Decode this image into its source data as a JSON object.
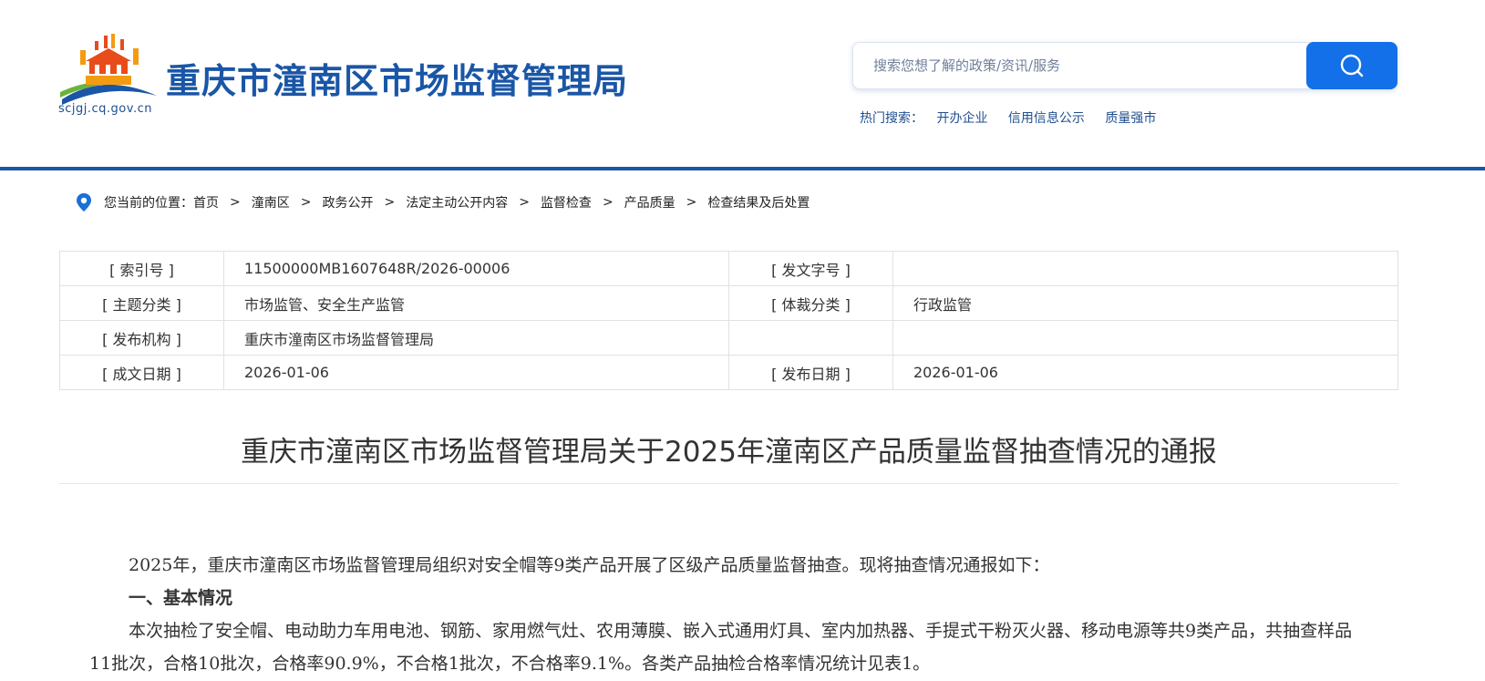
{
  "header": {
    "site_title": "重庆市潼南区市场监督管理局",
    "domain": "scjgj.cq.gov.cn",
    "search_placeholder": "搜索您想了解的政策/资讯/服务",
    "hot_label": "热门搜索：",
    "hot_links": [
      "开办企业",
      "信用信息公示",
      "质量强市"
    ],
    "brand_color": "#1a56a6",
    "search_button_color": "#1370e8",
    "search_icon": "search-icon"
  },
  "breadcrumb": {
    "prefix": "您当前的位置：",
    "icon": "location-pin-icon",
    "items": [
      "首页",
      "潼南区",
      "政务公开",
      "法定主动公开内容",
      "监督检查",
      "产品质量",
      "检查结果及后处置"
    ],
    "separator": ">"
  },
  "meta": {
    "rows": [
      {
        "l1": "[ 索引号 ]",
        "v1": "11500000MB1607648R/2026-00006",
        "l2": "[ 发文字号 ]",
        "v2": ""
      },
      {
        "l1": "[ 主题分类 ]",
        "v1": "市场监管、安全生产监管",
        "l2": "[ 体裁分类 ]",
        "v2": "行政监管"
      },
      {
        "l1": "[ 发布机构 ]",
        "v1": "重庆市潼南区市场监督管理局",
        "l2": "",
        "v2": ""
      },
      {
        "l1": "[ 成文日期 ]",
        "v1": "2026-01-06",
        "l2": "[ 发布日期 ]",
        "v2": "2026-01-06"
      }
    ]
  },
  "article": {
    "title": "重庆市潼南区市场监督管理局关于2025年潼南区产品质量监督抽查情况的通报",
    "intro": "2025年，重庆市潼南区市场监督管理局组织对安全帽等9类产品开展了区级产品质量监督抽查。现将抽查情况通报如下：",
    "section1_heading": "一、基本情况",
    "section1_para": "本次抽检了安全帽、电动助力车用电池、钢筋、家用燃气灶、农用薄膜、嵌入式通用灯具、室内加热器、手提式干粉灭火器、移动电源等共9类产品，共抽查样品11批次，合格10批次，合格率90.9%，不合格1批次，不合格率9.1%。各类产品抽检合格率情况统计见表1。"
  }
}
